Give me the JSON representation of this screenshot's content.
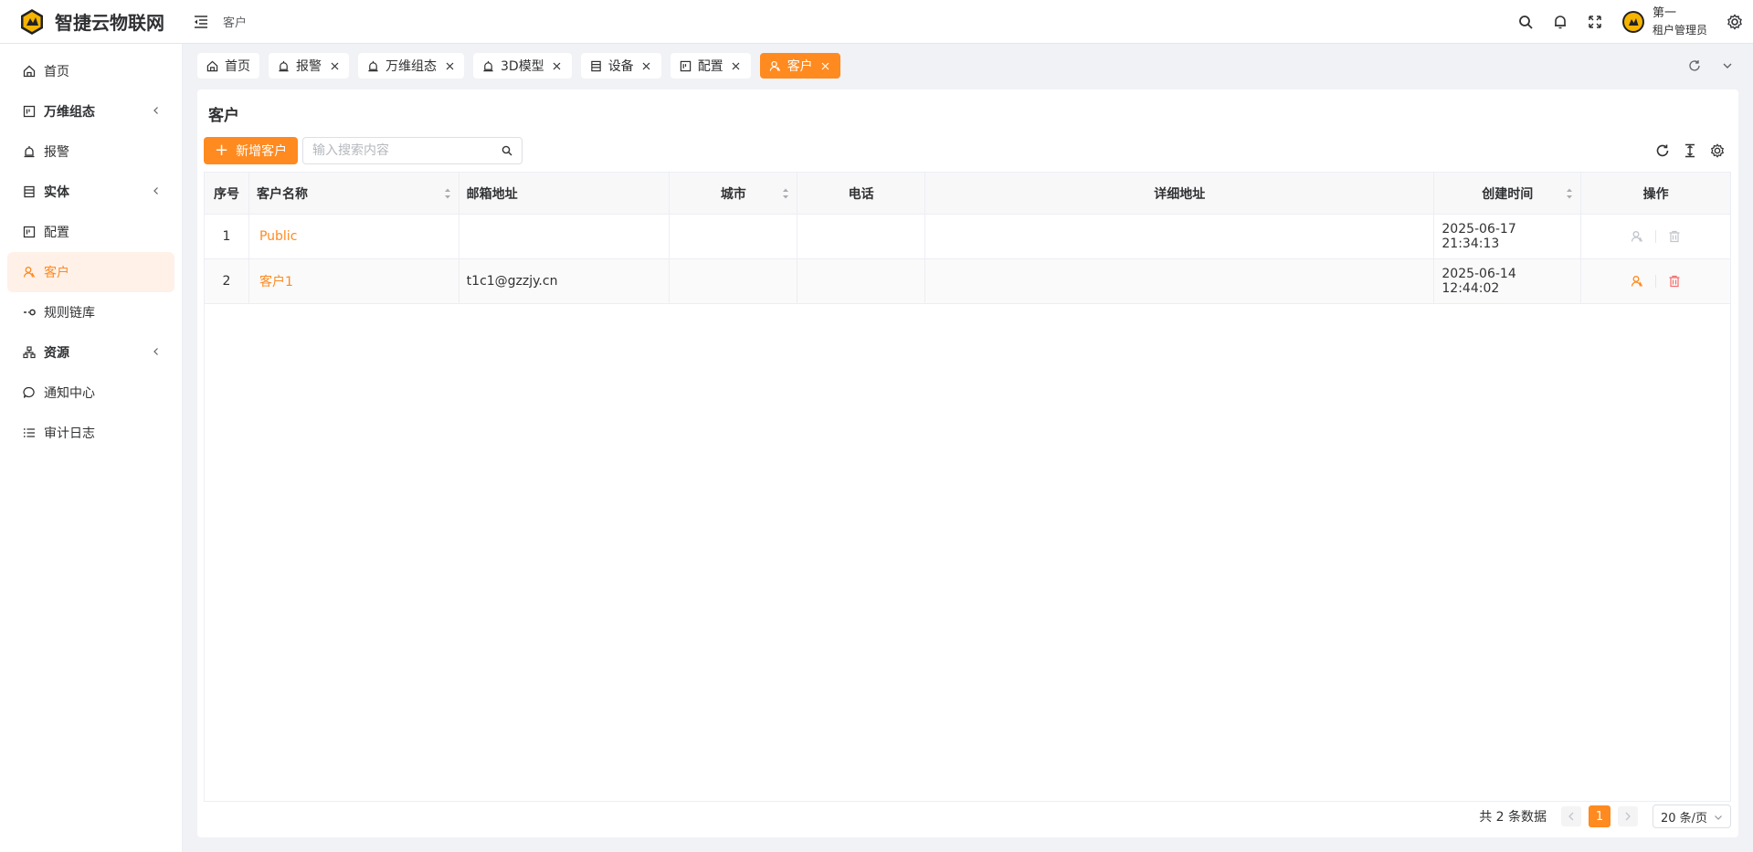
{
  "app": {
    "title": "智捷云物联网"
  },
  "header": {
    "breadcrumb": "客户",
    "user": {
      "name": "第一",
      "role": "租户管理员"
    }
  },
  "sidebar": {
    "items": [
      {
        "label": "首页",
        "icon": "home-icon"
      },
      {
        "label": "万维组态",
        "icon": "layout-icon",
        "submenu": true
      },
      {
        "label": "报警",
        "icon": "alarm-icon"
      },
      {
        "label": "实体",
        "icon": "entity-icon",
        "submenu": true
      },
      {
        "label": "配置",
        "icon": "config-icon"
      },
      {
        "label": "客户",
        "icon": "customer-icon",
        "active": true
      },
      {
        "label": "规则链库",
        "icon": "rule-chain-icon"
      },
      {
        "label": "资源",
        "icon": "resource-icon",
        "submenu": true
      },
      {
        "label": "通知中心",
        "icon": "notification-icon"
      },
      {
        "label": "审计日志",
        "icon": "audit-log-icon"
      }
    ]
  },
  "tabs": [
    {
      "label": "首页",
      "closable": false
    },
    {
      "label": "报警",
      "closable": true
    },
    {
      "label": "万维组态",
      "closable": true
    },
    {
      "label": "3D模型",
      "closable": true
    },
    {
      "label": "设备",
      "closable": true
    },
    {
      "label": "配置",
      "closable": true
    },
    {
      "label": "客户",
      "closable": true,
      "active": true
    }
  ],
  "page": {
    "title": "客户",
    "add_label": "新增客户",
    "search_placeholder": "输入搜索内容"
  },
  "table": {
    "columns": [
      "序号",
      "客户名称",
      "邮箱地址",
      "城市",
      "电话",
      "详细地址",
      "创建时间",
      "操作"
    ],
    "rows": [
      {
        "index": "1",
        "name": "Public",
        "email": "",
        "city": "",
        "phone": "",
        "address": "",
        "created": "2025-06-17 21:34:13",
        "actions_enabled": false
      },
      {
        "index": "2",
        "name": "客户1",
        "email": "t1c1@gzzjy.cn",
        "city": "",
        "phone": "",
        "address": "",
        "created": "2025-06-14 12:44:02",
        "actions_enabled": true
      }
    ]
  },
  "pagination": {
    "total_text": "共 2 条数据",
    "current_page": "1",
    "page_size": "20 条/页"
  },
  "colors": {
    "accent": "#ff8a1f",
    "danger": "#f56c6c",
    "active_bg": "#fff1e8"
  }
}
